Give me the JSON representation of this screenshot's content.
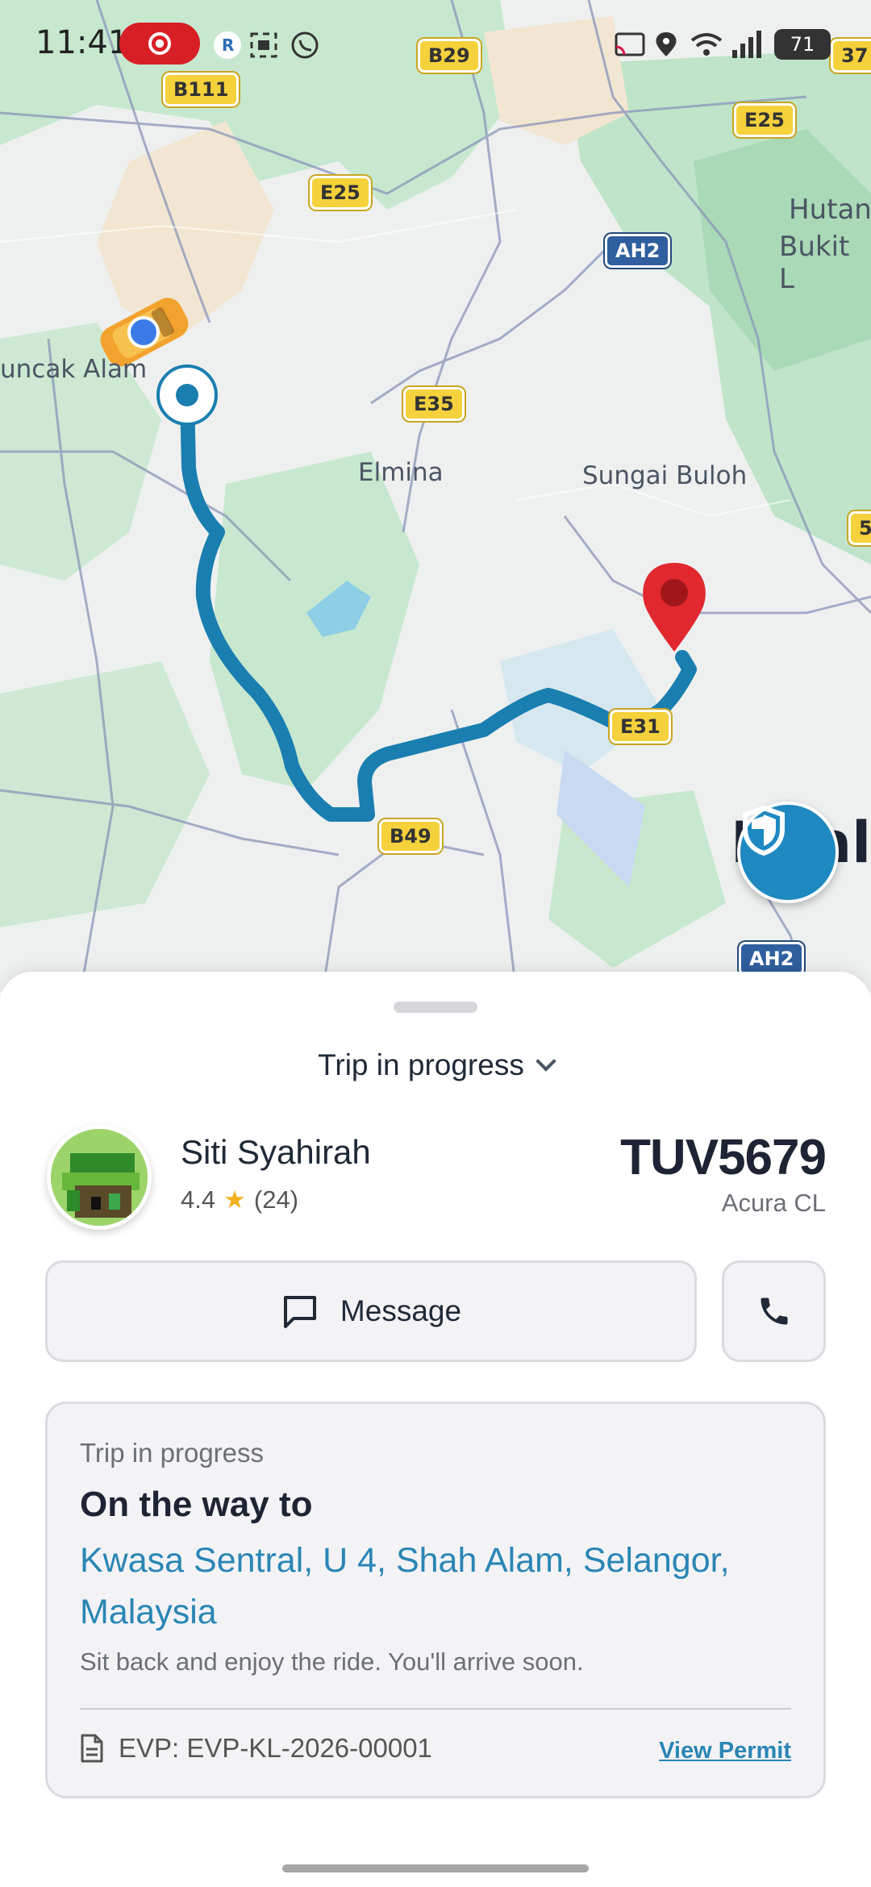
{
  "status_bar": {
    "time": "11:41",
    "battery": "71"
  },
  "map": {
    "place_labels": [
      "uncak Alam",
      "Elmina",
      "Sungai Buloh",
      "Hutan",
      "Bukit L",
      "Kuali"
    ],
    "road_shields": [
      "B111",
      "B29",
      "E25",
      "E25",
      "AH2",
      "E35",
      "E31",
      "B49",
      "AH2",
      "37",
      "5"
    ],
    "route_color": "#1a7eb0",
    "destination_pin_color": "#e0282e"
  },
  "sheet": {
    "trip_status_header": "Trip in progress",
    "driver": {
      "name": "Siti Syahirah",
      "rating": "4.4",
      "rating_count": "(24)"
    },
    "vehicle": {
      "plate": "TUV5679",
      "model": "Acura CL"
    },
    "actions": {
      "message_label": "Message"
    },
    "trip_card": {
      "status": "Trip in progress",
      "heading": "On the way to",
      "destination": "Kwasa Sentral, U 4, Shah Alam, Selangor, Malaysia",
      "subtext": "Sit back and enjoy the ride. You'll arrive soon.",
      "evp": "EVP: EVP-KL-2026-00001",
      "permit_link": "View Permit"
    }
  },
  "icons": {
    "message": "chat-bubble-icon",
    "call": "phone-icon",
    "document": "document-icon",
    "safety": "shield-check-icon"
  }
}
